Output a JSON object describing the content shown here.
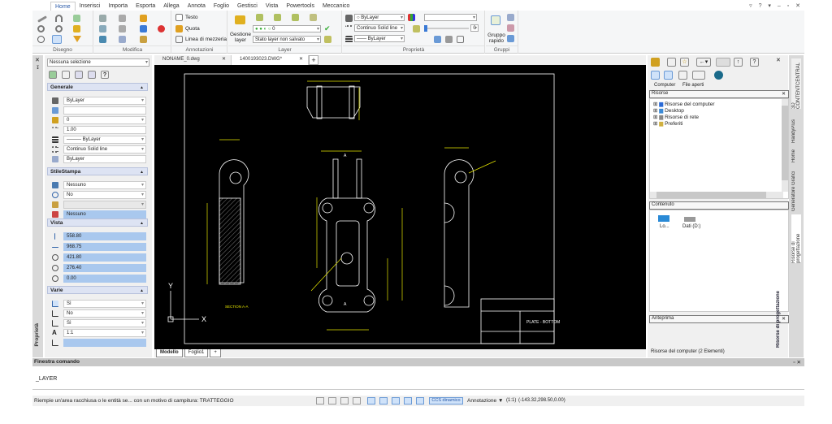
{
  "ribbon": {
    "tabs": [
      "Home",
      "Inserisci",
      "Importa",
      "Esporta",
      "Allega",
      "Annota",
      "Foglio",
      "Gestisci",
      "Vista",
      "Powertools",
      "Meccanico"
    ],
    "active_tab": "Home",
    "window_controls": "▿ ? ▾ ‒ ▫ ✕",
    "groups": {
      "disegno": "Disegno",
      "modifica": "Modifica",
      "annotazioni": "Annotazioni",
      "layer": "Layer",
      "proprieta": "Proprietà",
      "gruppi": "Gruppi"
    },
    "annotazioni": {
      "testo": "Testo",
      "quota": "Quota",
      "linea": "Linea di mezzeria"
    },
    "layer": {
      "gestione": "Gestione layer",
      "current_layer": "0",
      "state": "Stato layer non salvato"
    },
    "proprieta": {
      "color": "ByLayer",
      "linetype": "Continuo    Solid line",
      "lineweight": "—— ByLayer",
      "transparency": "0"
    },
    "gruppi": {
      "gruppo_rapido": "Gruppo rapido"
    }
  },
  "left_panel": {
    "vertical_label": "Proprietà",
    "selection": "Nessuna selezione",
    "help": "?",
    "sections": {
      "generale": {
        "title": "Generale",
        "rows": [
          "ByLayer",
          "",
          "0",
          "1.00",
          "——— ByLayer",
          "Continuo    Solid line",
          "ByLayer"
        ]
      },
      "stile": {
        "title": "StileStampa",
        "rows": [
          "Nessuno",
          "No",
          "",
          "Nessuno"
        ]
      },
      "vista": {
        "title": "Vista",
        "rows": [
          "558.80",
          "968.75",
          "421.80",
          "276.40",
          "0.00"
        ]
      },
      "varie": {
        "title": "Varie",
        "rows": [
          "Sì",
          "No",
          "Sì",
          "1:1",
          ""
        ]
      }
    }
  },
  "doc_tabs": [
    "NONAME_0.dwg",
    "1400193023.DWG*"
  ],
  "active_doc": "1400193023.DWG*",
  "model_tabs": [
    "Modello",
    "Foglio1",
    "+"
  ],
  "drawing": {
    "section_label": "SECTION A-A",
    "title": "PLATE - BOTTOM",
    "section_mark": "A",
    "axis_x": "X",
    "axis_y": "Y"
  },
  "right_panel": {
    "tabs": [
      "Computer",
      "File aperti"
    ],
    "resources_title": "Risorse",
    "tree": [
      "Risorse del computer",
      "Desktop",
      "Risorse di rete",
      "Preferiti"
    ],
    "content_title": "Contenuto",
    "content_items": [
      "Lo...",
      "Dati (D:)"
    ],
    "preview_title": "Anteprima",
    "footer": "Risorse del computer (2 Elementi)",
    "vertical_tabs": [
      "3D CONTENTCENTRAL",
      "HandyPlus",
      "Home",
      "Generatore Grafici",
      "Risorse di progettazione"
    ],
    "vertical_active": "Risorse di progettazione"
  },
  "command": {
    "title": "Finestra comando",
    "history": "_LAYER",
    "prompt": ""
  },
  "status": {
    "message": "Riempie un'area racchiusa o le entità se... con un motivo di campitura:  TRATTEGGIO",
    "ccs": "CCS dinamico",
    "annotation": "Annotazione",
    "scale": "(1:1)",
    "coords": "(-143.32,298.50,0.00)"
  },
  "colors": {
    "accent": "#2a5aa8",
    "cad_bg": "#000000",
    "dim": "#e5e500",
    "geom": "#ffffff",
    "highlight": "#a9c8ee"
  }
}
